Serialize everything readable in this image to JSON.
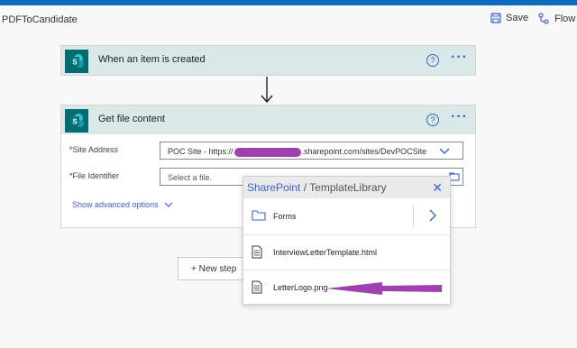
{
  "header": {
    "flow_name": "PDFToCandidate",
    "save_label": "Save",
    "flow_label": "Flow"
  },
  "trigger_card": {
    "title": "When an item is created",
    "help_icon": "?",
    "more_icon": "···",
    "connector_icon": "sharepoint-icon"
  },
  "action_card": {
    "title": "Get file content",
    "help_icon": "?",
    "more_icon": "···",
    "site_address": {
      "label": "Site Address",
      "value_prefix": "POC Site - https://",
      "value_suffix": ".sharepoint.com/sites/DevPOCSite"
    },
    "file_identifier": {
      "label": "File Identifier",
      "placeholder": "Select a file."
    },
    "show_advanced": "Show advanced options"
  },
  "new_step": "+ New step",
  "file_picker": {
    "root": "SharePoint",
    "separator": " / ",
    "path": "TemplateLibrary",
    "close_icon": "✕",
    "items": [
      {
        "name": "Forms",
        "type": "folder"
      },
      {
        "name": "InterviewLetterTemplate.html",
        "type": "file"
      },
      {
        "name": "LetterLogo.png",
        "type": "file"
      }
    ]
  },
  "colors": {
    "accent": "#3b62d4",
    "topbar": "#0f6cbd",
    "card_header": "#d8e9e8",
    "sharepoint": "#036c70",
    "annotation": "#a040b0"
  }
}
